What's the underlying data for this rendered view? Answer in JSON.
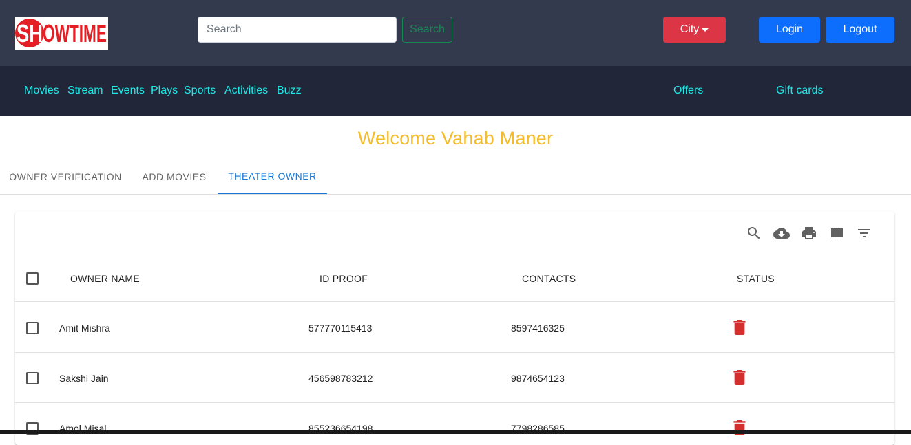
{
  "header": {
    "logo_text": "SHOWTIME",
    "search": {
      "placeholder": "Search",
      "value": ""
    },
    "search_button": "Search",
    "city_button": "City",
    "login_button": "Login",
    "logout_button": "Logout"
  },
  "nav": {
    "items": [
      {
        "label": "Movies"
      },
      {
        "label": "Stream"
      },
      {
        "label": "Events"
      },
      {
        "label": "Plays"
      },
      {
        "label": "Sports"
      },
      {
        "label": "Activities"
      },
      {
        "label": "Buzz"
      }
    ],
    "right_items": [
      {
        "label": "Offers"
      },
      {
        "label": "Gift cards"
      }
    ]
  },
  "welcome_text": "Welcome Vahab Maner",
  "tabs": [
    {
      "label": "OWNER VERIFICATION",
      "active": false
    },
    {
      "label": "ADD MOVIES",
      "active": false
    },
    {
      "label": "THEATER OWNER",
      "active": true
    }
  ],
  "table": {
    "toolbar_icons": [
      "search-icon",
      "cloud-download-icon",
      "print-icon",
      "view-column-icon",
      "filter-list-icon"
    ],
    "columns": [
      "OWNER NAME",
      "ID PROOF",
      "CONTACTS",
      "STATUS"
    ],
    "rows": [
      {
        "name": "Amit Mishra",
        "id_proof": "577770115413",
        "contact": "8597416325",
        "status_icon": "delete-icon"
      },
      {
        "name": "Sakshi Jain",
        "id_proof": "456598783212",
        "contact": "9874654123",
        "status_icon": "delete-icon"
      },
      {
        "name": "Amol Misal",
        "id_proof": "855236654198",
        "contact": "7798286585",
        "status_icon": "delete-icon"
      }
    ]
  },
  "colors": {
    "topbar": "#343a4e",
    "navbar": "#222639",
    "nav_link": "#1de9e9",
    "welcome": "#f5bc2a",
    "city_button": "#dc3545",
    "primary_button": "#0d6efd",
    "search_button": "#198754",
    "active_tab": "#1976d2",
    "delete_icon": "#d32f2f"
  }
}
